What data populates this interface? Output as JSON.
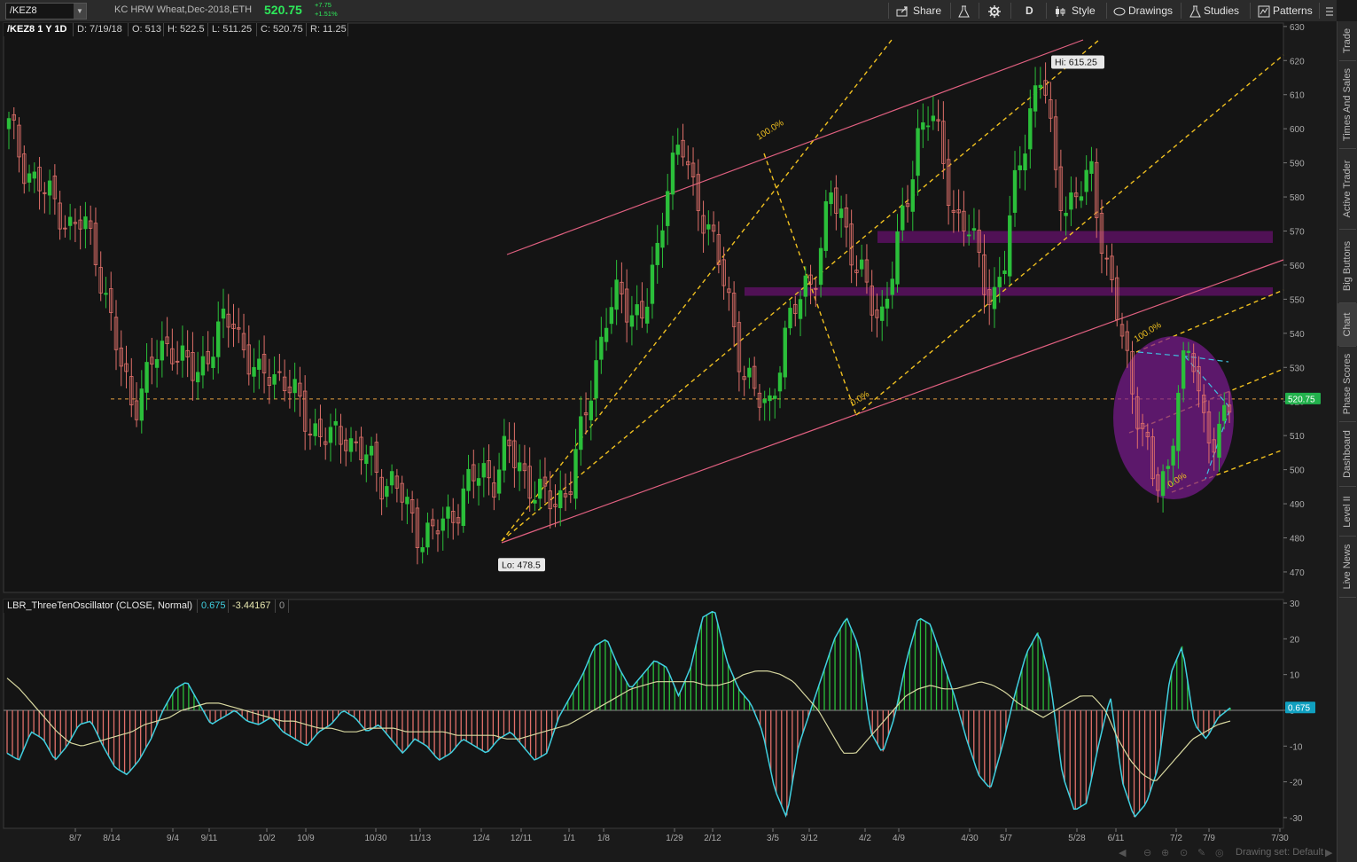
{
  "window": {
    "symbol": "/KEZ8",
    "description": "KC HRW Wheat,Dec-2018,ETH",
    "last_price": "520.75",
    "net_change": "+7.75",
    "pct_change": "+1.51%"
  },
  "toolbar": {
    "share": "Share",
    "timeframe": "D",
    "style": "Style",
    "drawings": "Drawings",
    "studies": "Studies",
    "patterns": "Patterns"
  },
  "info_bar": {
    "title": "/KEZ8 1 Y 1D",
    "date": "D: 7/19/18",
    "open": "O: 513",
    "high": "H: 522.5",
    "low": "L: 511.25",
    "close": "C: 520.75",
    "range": "R: 11.25"
  },
  "oscillator_bar": {
    "name": "LBR_ThreeTenOscillator (CLOSE, Normal)",
    "v1": "0.675",
    "v2": "-3.44167",
    "v3": "0"
  },
  "sidebar": {
    "tabs": [
      "Trade",
      "Times And Sales",
      "Active Trader",
      "Big Buttons",
      "Chart",
      "Phase Scores",
      "Dashboard",
      "Level II",
      "Live News"
    ],
    "selected": "Chart"
  },
  "footer": {
    "drawing_set": "Drawing set: Default"
  },
  "colors": {
    "up": "#2bbf3a",
    "down": "#e0706a",
    "accent": "#2ee85a",
    "price_tag": "#22b14c",
    "channel": "#e06080",
    "fib": "#f0c020",
    "osc_line": "#40d0e0",
    "signal": "#d8d8a0",
    "zone": "#5a1060"
  },
  "chart_data": [
    {
      "type": "candlestick",
      "title": "/KEZ8 1 Y 1D",
      "y_axis": {
        "ticks": [
          470,
          480,
          490,
          500,
          510,
          520,
          530,
          540,
          550,
          560,
          570,
          580,
          590,
          600,
          610,
          620,
          630
        ],
        "range": [
          464,
          631
        ]
      },
      "x_axis": {
        "ticks": [
          "8/7",
          "8/14",
          "9/4",
          "9/11",
          "10/2",
          "10/9",
          "10/30",
          "11/13",
          "12/4",
          "12/11",
          "1/1",
          "1/8",
          "1/29",
          "2/12",
          "3/5",
          "3/12",
          "4/2",
          "4/9",
          "4/30",
          "5/7",
          "5/28",
          "6/11",
          "7/2",
          "7/9",
          "7/30"
        ]
      },
      "current_price": 520.75,
      "annotations": [
        {
          "label": "Hi: 615.25",
          "value": 615.25
        },
        {
          "label": "Lo: 478.5",
          "value": 478.5
        },
        {
          "label": "100.0%"
        },
        {
          "label": "0.0%"
        },
        {
          "label": "100.0%"
        },
        {
          "label": "0.0%"
        }
      ],
      "resistance_zones": [
        [
          566.5,
          570
        ],
        [
          551,
          553.5
        ]
      ],
      "series_anchor": [
        600,
        592,
        585,
        580,
        578,
        570,
        572,
        565,
        545,
        530,
        520,
        525,
        535,
        538,
        530,
        528,
        535,
        540,
        545,
        535,
        525,
        530,
        527,
        520,
        515,
        510,
        508,
        512,
        505,
        502,
        498,
        495,
        488,
        482,
        480,
        485,
        490,
        495,
        500,
        498,
        505,
        502,
        495,
        490,
        492,
        495,
        510,
        530,
        545,
        550,
        548,
        545,
        560,
        590,
        595,
        580,
        575,
        560,
        545,
        530,
        520,
        518,
        535,
        545,
        555,
        560,
        580,
        575,
        560,
        550,
        545,
        560,
        575,
        600,
        605,
        590,
        575,
        570,
        560,
        550,
        560,
        590,
        605,
        615,
        590,
        575,
        580,
        590,
        560,
        545,
        530,
        510,
        495,
        500,
        525,
        535,
        515,
        505,
        520
      ]
    },
    {
      "type": "line",
      "title": "LBR_ThreeTenOscillator (CLOSE, Normal)",
      "y_axis": {
        "ticks": [
          -30,
          -20,
          -10,
          0,
          10,
          20,
          30
        ],
        "range": [
          -33,
          31
        ]
      },
      "current_value": 0.675,
      "series": [
        {
          "name": "ThreeTen",
          "values": [
            -12,
            -14,
            -6,
            -8,
            -14,
            -10,
            -4,
            -3,
            -10,
            -16,
            -18,
            -14,
            -8,
            0,
            6,
            8,
            2,
            -4,
            -2,
            0,
            -3,
            -4,
            -2,
            -6,
            -8,
            -10,
            -6,
            -4,
            0,
            -2,
            -6,
            -4,
            -8,
            -12,
            -8,
            -10,
            -14,
            -12,
            -8,
            -10,
            -12,
            -8,
            -6,
            -10,
            -14,
            -12,
            -2,
            4,
            10,
            18,
            20,
            12,
            6,
            10,
            14,
            12,
            4,
            12,
            26,
            28,
            14,
            6,
            2,
            -6,
            -22,
            -30,
            -10,
            0,
            10,
            20,
            26,
            18,
            -6,
            -12,
            -2,
            14,
            26,
            24,
            14,
            4,
            -8,
            -18,
            -22,
            -10,
            4,
            16,
            22,
            8,
            -18,
            -28,
            -26,
            -10,
            4,
            -20,
            -30,
            -26,
            -16,
            10,
            18,
            -4,
            -8,
            -2,
            0.675
          ]
        },
        {
          "name": "Signal",
          "values": [
            9,
            6,
            2,
            -2,
            -6,
            -9,
            -10,
            -9,
            -8,
            -7,
            -6,
            -4,
            -3,
            -2,
            0,
            1,
            2,
            2,
            1,
            0,
            -1,
            -2,
            -3,
            -3,
            -4,
            -5,
            -5,
            -6,
            -6,
            -5,
            -5,
            -5,
            -6,
            -6,
            -6,
            -6,
            -7,
            -7,
            -7,
            -7,
            -8,
            -8,
            -7,
            -6,
            -5,
            -4,
            -2,
            0,
            2,
            4,
            6,
            7,
            8,
            8,
            8,
            8,
            7,
            7,
            8,
            10,
            11,
            11,
            10,
            8,
            4,
            0,
            -6,
            -12,
            -12,
            -8,
            -4,
            0,
            4,
            6,
            7,
            6,
            6,
            7,
            8,
            7,
            5,
            2,
            0,
            -2,
            0,
            2,
            4,
            4,
            0,
            -8,
            -14,
            -18,
            -20,
            -16,
            -12,
            -8,
            -6,
            -4,
            -3
          ]
        }
      ]
    }
  ]
}
